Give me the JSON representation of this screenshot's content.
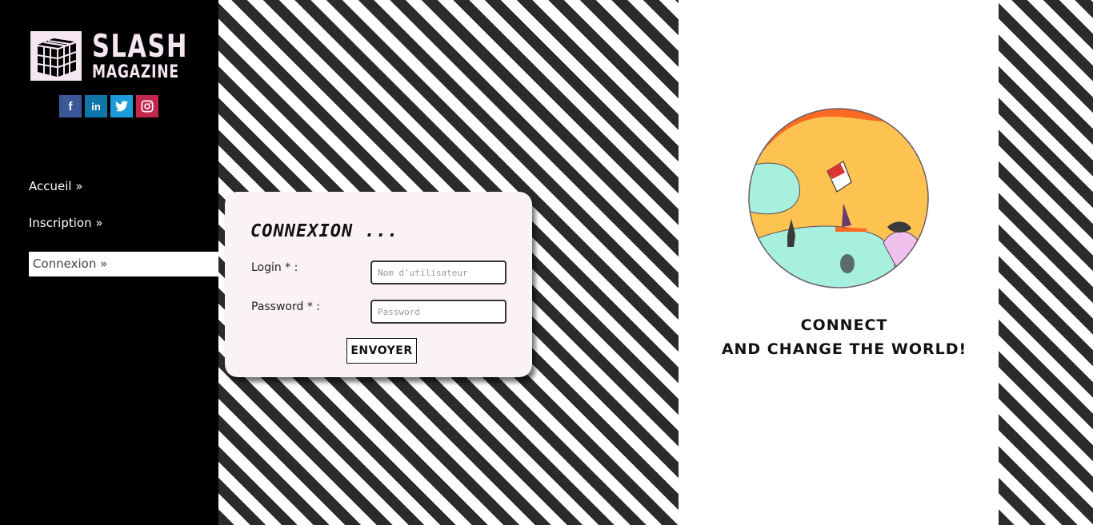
{
  "brand": {
    "name_line1": "SLASH",
    "name_line2": "MAGAZINE",
    "logo_icon": "rubiks-cube-icon"
  },
  "socials": [
    {
      "name": "facebook",
      "glyph": "f",
      "color": "#3b5998"
    },
    {
      "name": "linkedin",
      "glyph": "in",
      "color": "#0e76a8"
    },
    {
      "name": "twitter",
      "glyph": "🐦",
      "color": "#1d9bd8"
    },
    {
      "name": "instagram",
      "glyph": "◎",
      "color": "#c3274e"
    }
  ],
  "nav": {
    "items": [
      {
        "label": "Accueil »"
      },
      {
        "label": "Inscription »"
      },
      {
        "label": "Connexion »",
        "active": true
      }
    ]
  },
  "login": {
    "title": "CONNEXION ...",
    "login_label": "Login * :",
    "login_placeholder": "Nom d'utilisateur",
    "password_label": "Password * :",
    "password_placeholder": "Password",
    "submit_label": "ENVOYER"
  },
  "promo": {
    "line1": "CONNECT",
    "line2": "AND CHANGE THE WORLD!"
  },
  "colors": {
    "sidebar_bg": "#000000",
    "stripe_dark": "#2b2b2b",
    "card_bg": "#fbf2f3",
    "logo_text": "#f6e6f2"
  }
}
